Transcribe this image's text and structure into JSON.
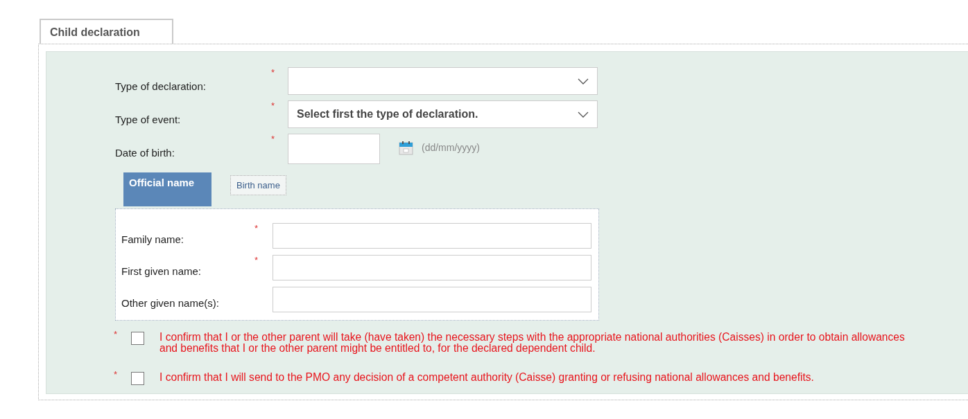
{
  "tab": {
    "label": "Child declaration",
    "selected": true
  },
  "fields": [
    {
      "label": "Type of declaration:",
      "mark": "*",
      "kind": "select"
    },
    {
      "label": "Type of event:",
      "mark": "*",
      "kind": "select",
      "value": "Select first the type of declaration."
    },
    {
      "label": "Date of birth:",
      "mark": "*",
      "kind": "date",
      "hint": "(dd/mm/yyyy)"
    }
  ],
  "name_tabs": [
    {
      "label": "Official name",
      "selected": true
    },
    {
      "label": "Birth name",
      "selected": false
    }
  ],
  "name_fields": [
    {
      "label": "Family name:",
      "mark": "*"
    },
    {
      "label": "First given name:",
      "mark": "*"
    },
    {
      "label": "Other given name(s):"
    }
  ],
  "confirmations": [
    {
      "mark": "*",
      "checked": false,
      "text": "I confirm that I or the other parent will take (have taken) the necessary steps with the appropriate national authorities (Caisses) in order to obtain allowances and benefits that I or the other parent might be entitled to, for the declared dependent child."
    },
    {
      "mark": "*",
      "checked": false,
      "text": "I confirm that I will send to the PMO any decision of a competent authority (Caisse) granting or refusing national allowances and benefits."
    }
  ]
}
